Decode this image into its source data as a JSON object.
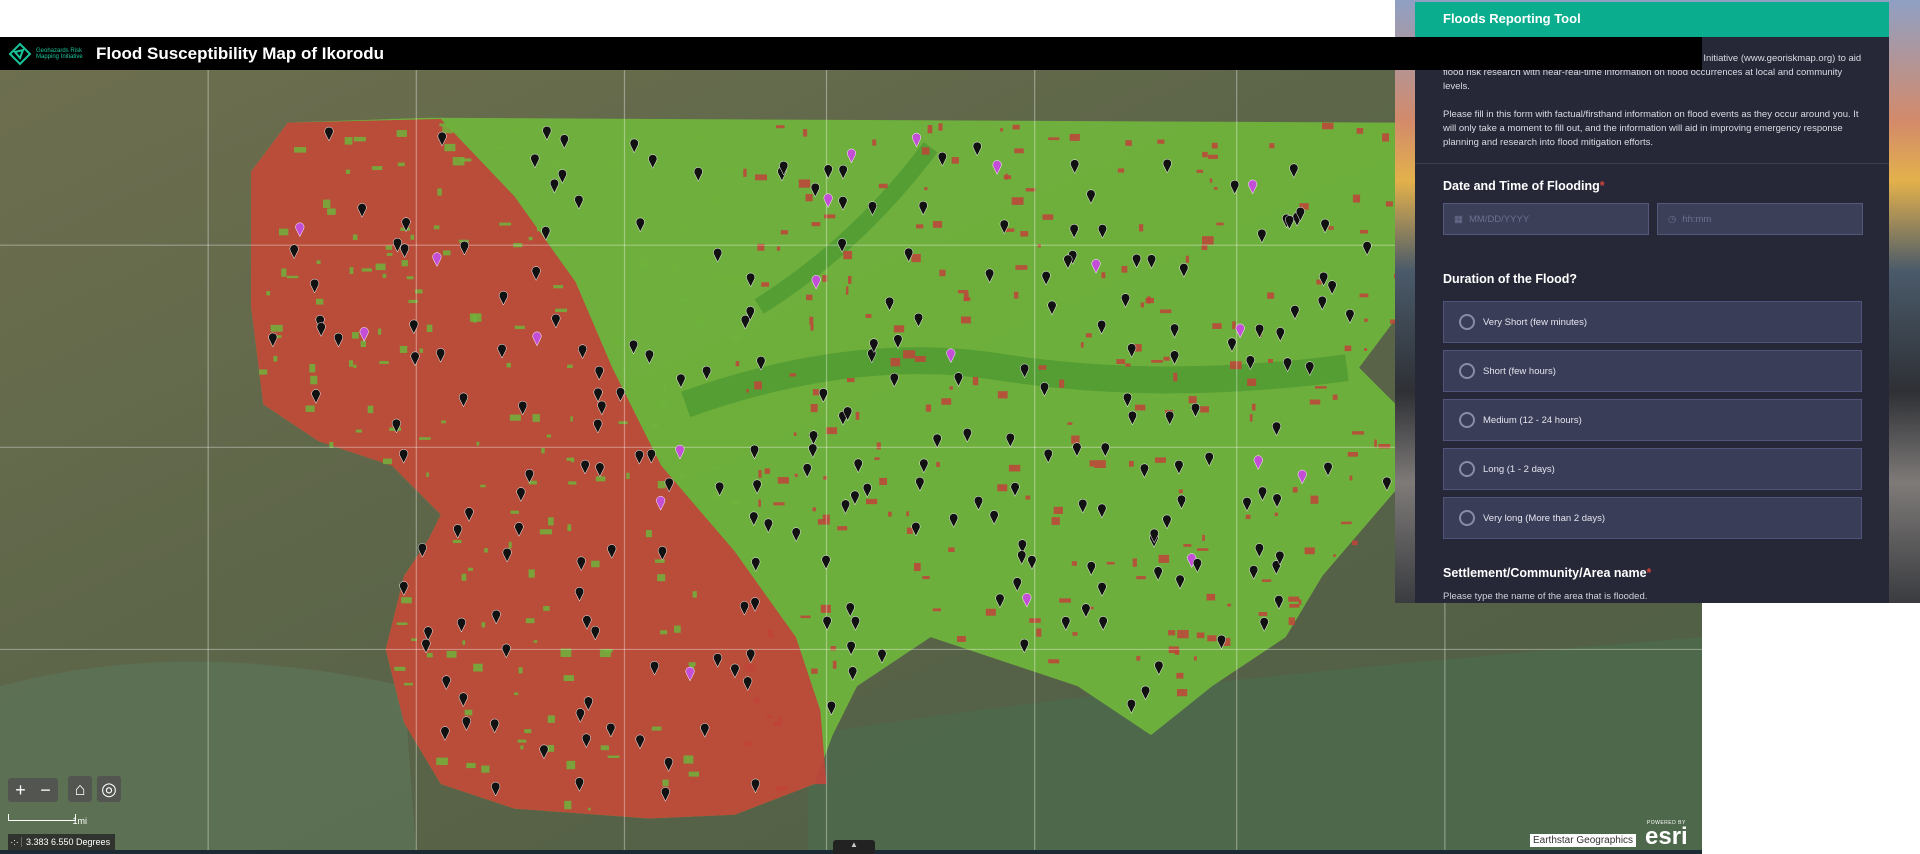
{
  "map": {
    "logo_text": "Geohazards Risk Mapping Initiative",
    "title": "Flood Susceptibility Map of Ikorodu",
    "zoom_in": "+",
    "zoom_out": "−",
    "home_icon": "⌂",
    "locate_icon": "◎",
    "scale_label": "1mi",
    "coordinates": "3.383 6.550 Degrees",
    "attribution": "Earthstar Geographics",
    "powered_by": "POWERED BY",
    "esri": "esri",
    "toggle": "▲",
    "colors": {
      "high": "#c0443a",
      "low": "#6fb33c",
      "pin": "#111111",
      "report_pin": "#c24fd6"
    }
  },
  "form": {
    "title": "Floods Reporting Tool",
    "desc1": "This survey was developed by the Geohazards Risk Mapping Initiative (www.georiskmap.org) to aid flood risk research with near-real-time information on flood occurrences at local and community levels.",
    "desc2": "Please fill in this form with factual/firsthand information on flood events as they occur around you. It will only take a moment to fill out, and the information will aid in improving emergency response planning and research into flood mitigation efforts.",
    "q_date": "Date and Time of Flooding",
    "date_placeholder": "MM/DD/YYYY",
    "time_placeholder": "hh:mm",
    "q_duration": "Duration of the Flood?",
    "options": [
      "Very Short (few minutes)",
      "Short (few hours)",
      "Medium (12 - 24 hours)",
      "Long (1 - 2 days)",
      "Very long (More than 2 days)"
    ],
    "q_settlement": "Settlement/Community/Area name",
    "settlement_help": "Please type the name of the area that is flooded.",
    "required_mark": "*"
  }
}
